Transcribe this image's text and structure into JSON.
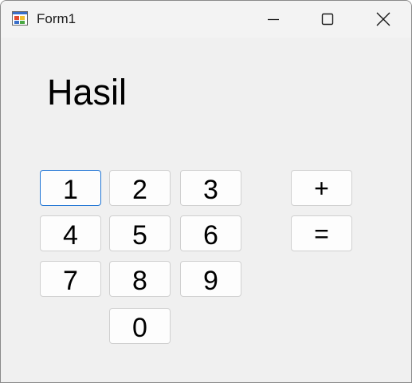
{
  "window": {
    "title": "Form1"
  },
  "display": {
    "result_label": "Hasil"
  },
  "keypad": {
    "b1": "1",
    "b2": "2",
    "b3": "3",
    "b4": "4",
    "b5": "5",
    "b6": "6",
    "b7": "7",
    "b8": "8",
    "b9": "9",
    "b0": "0",
    "plus": "+",
    "equals": "="
  },
  "icons": {
    "app": "winforms-app-icon",
    "minimize": "minimize-icon",
    "maximize": "maximize-icon",
    "close": "close-icon"
  },
  "colors": {
    "focus_border": "#1f74d4",
    "form_background": "#f0f0f0"
  }
}
